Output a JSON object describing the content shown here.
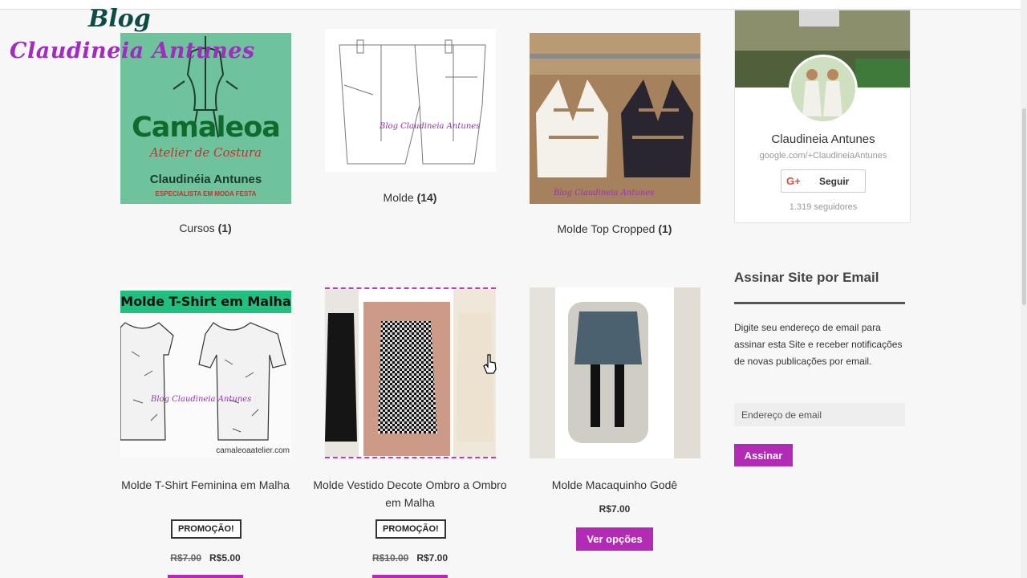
{
  "watermark": {
    "line1": "Blog",
    "line2": "Claudineia Antunes"
  },
  "categories": [
    {
      "name": "Cursos",
      "count": "(1)"
    },
    {
      "name": "Molde",
      "count": "(14)"
    },
    {
      "name": "Molde Top Cropped",
      "count": "(1)"
    }
  ],
  "thumb_text": {
    "camaleoa": "Camaleoa",
    "atelier": "Atelier de Costura",
    "owner": "Claudinéia Antunes",
    "tagline": "ESPECIALISTA EM MODA FESTA",
    "overlay": "Blog Claudineia Antunes",
    "tshirt_header": "Molde T-Shirt em Malha",
    "site": "camaleoaatelier.com"
  },
  "products": [
    {
      "title": "Molde T-Shirt Feminina em Malha",
      "badge": "PROMOÇÃO!",
      "old_price": "R$7.00",
      "price": "R$5.00"
    },
    {
      "title": "Molde Vestido Decote Ombro a Ombro em Malha",
      "badge": "PROMOÇÃO!",
      "old_price": "R$10.00",
      "price": "R$7.00"
    },
    {
      "title": "Molde Macaquinho Godê",
      "price": "R$7.00",
      "button": "Ver opções"
    }
  ],
  "sidebar": {
    "gplus": {
      "name": "Claudineia Antunes",
      "url": "google.com/+ClaudineiaAntunes",
      "icon": "G+",
      "follow_label": "Seguir",
      "followers": "1.319 seguidores"
    },
    "subscribe": {
      "title": "Assinar Site por Email",
      "description": "Digite seu endereço de email para assinar esta Site e receber notificações de novas publicações por email.",
      "placeholder": "Endereço de email",
      "button": "Assinar"
    }
  },
  "colors": {
    "accent": "#b12bb4",
    "background": "#f7f7f7"
  }
}
